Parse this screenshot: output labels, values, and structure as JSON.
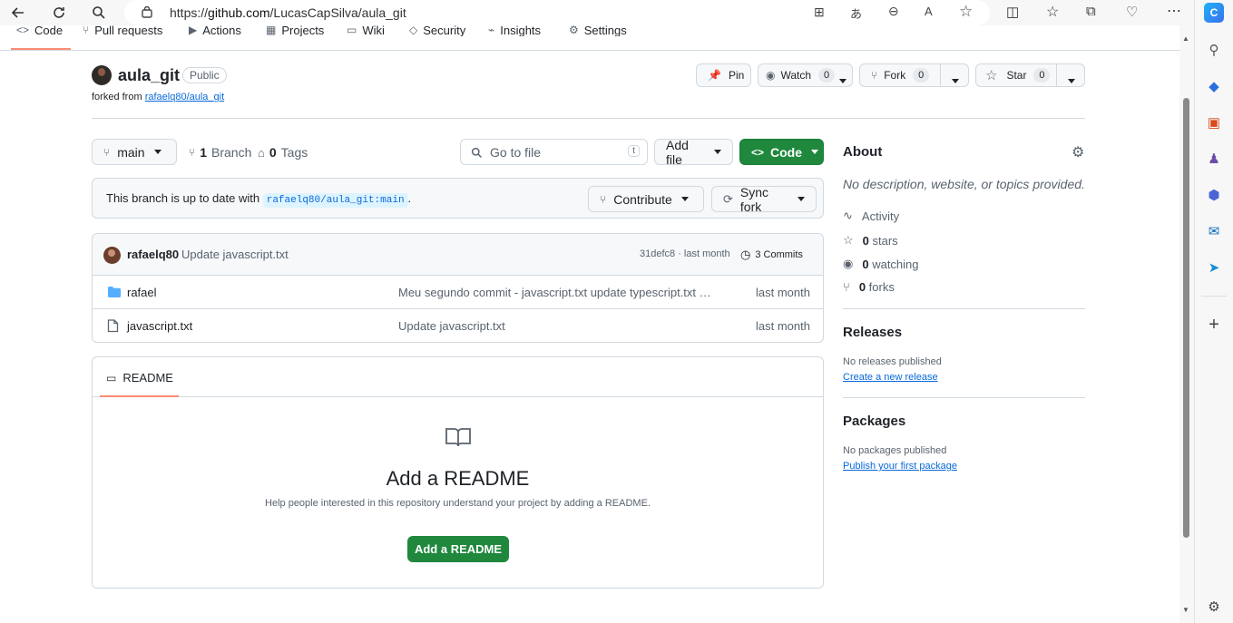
{
  "browser": {
    "url_prefix": "https://",
    "url_host": "github.com",
    "url_path": "/LucasCapSilva/aula_git"
  },
  "repo_tabs": [
    {
      "label": "Code",
      "icon": "code-icon"
    },
    {
      "label": "Pull requests",
      "icon": "pull-request-icon"
    },
    {
      "label": "Actions",
      "icon": "play-icon"
    },
    {
      "label": "Projects",
      "icon": "table-icon"
    },
    {
      "label": "Wiki",
      "icon": "book-icon"
    },
    {
      "label": "Security",
      "icon": "shield-icon"
    },
    {
      "label": "Insights",
      "icon": "graph-icon"
    },
    {
      "label": "Settings",
      "icon": "gear-icon"
    }
  ],
  "repo": {
    "name": "aula_git",
    "visibility": "Public",
    "forked_from_prefix": "forked from",
    "forked_from": "rafaelq80/aula_git"
  },
  "header_buttons": {
    "pin": "Pin",
    "watch": "Watch",
    "watch_count": "0",
    "fork": "Fork",
    "fork_count": "0",
    "star": "Star",
    "star_count": "0"
  },
  "toolbar": {
    "branch": "main",
    "branches_count": "1",
    "branches_label": "Branch",
    "tags_count": "0",
    "tags_label": "Tags",
    "go_to_file_placeholder": "Go to file",
    "go_to_file_shortcut": "t",
    "add_file": "Add file",
    "code": "Code"
  },
  "branch_status": {
    "text": "This branch is up to date with",
    "ref": "rafaelq80/aula_git:main",
    "period": ".",
    "contribute": "Contribute",
    "sync_fork": "Sync fork"
  },
  "latest_commit": {
    "author": "rafaelq80",
    "message": "Update javascript.txt",
    "sha_time": "31defc8 · last month",
    "commits_label": "3 Commits"
  },
  "files": [
    {
      "name": "rafael",
      "type": "folder",
      "message": "Meu segundo commit - javascript.txt update typescript.txt cr...",
      "date": "last month"
    },
    {
      "name": "javascript.txt",
      "type": "file",
      "message": "Update javascript.txt",
      "date": "last month"
    }
  ],
  "readme": {
    "tab": "README",
    "title": "Add a README",
    "subtitle": "Help people interested in this repository understand your project by adding a README.",
    "button": "Add a README"
  },
  "about": {
    "title": "About",
    "description": "No description, website, or topics provided.",
    "activity": "Activity",
    "stars_count": "0",
    "stars_label": "stars",
    "watching_count": "0",
    "watching_label": "watching",
    "forks_count": "0",
    "forks_label": "forks"
  },
  "releases": {
    "title": "Releases",
    "empty": "No releases published",
    "link": "Create a new release"
  },
  "packages": {
    "title": "Packages",
    "empty": "No packages published",
    "link": "Publish your first package"
  },
  "colors": {
    "accent_green": "#1f883d",
    "link_blue": "#0969da",
    "active_tab_underline": "#fd8c73"
  }
}
